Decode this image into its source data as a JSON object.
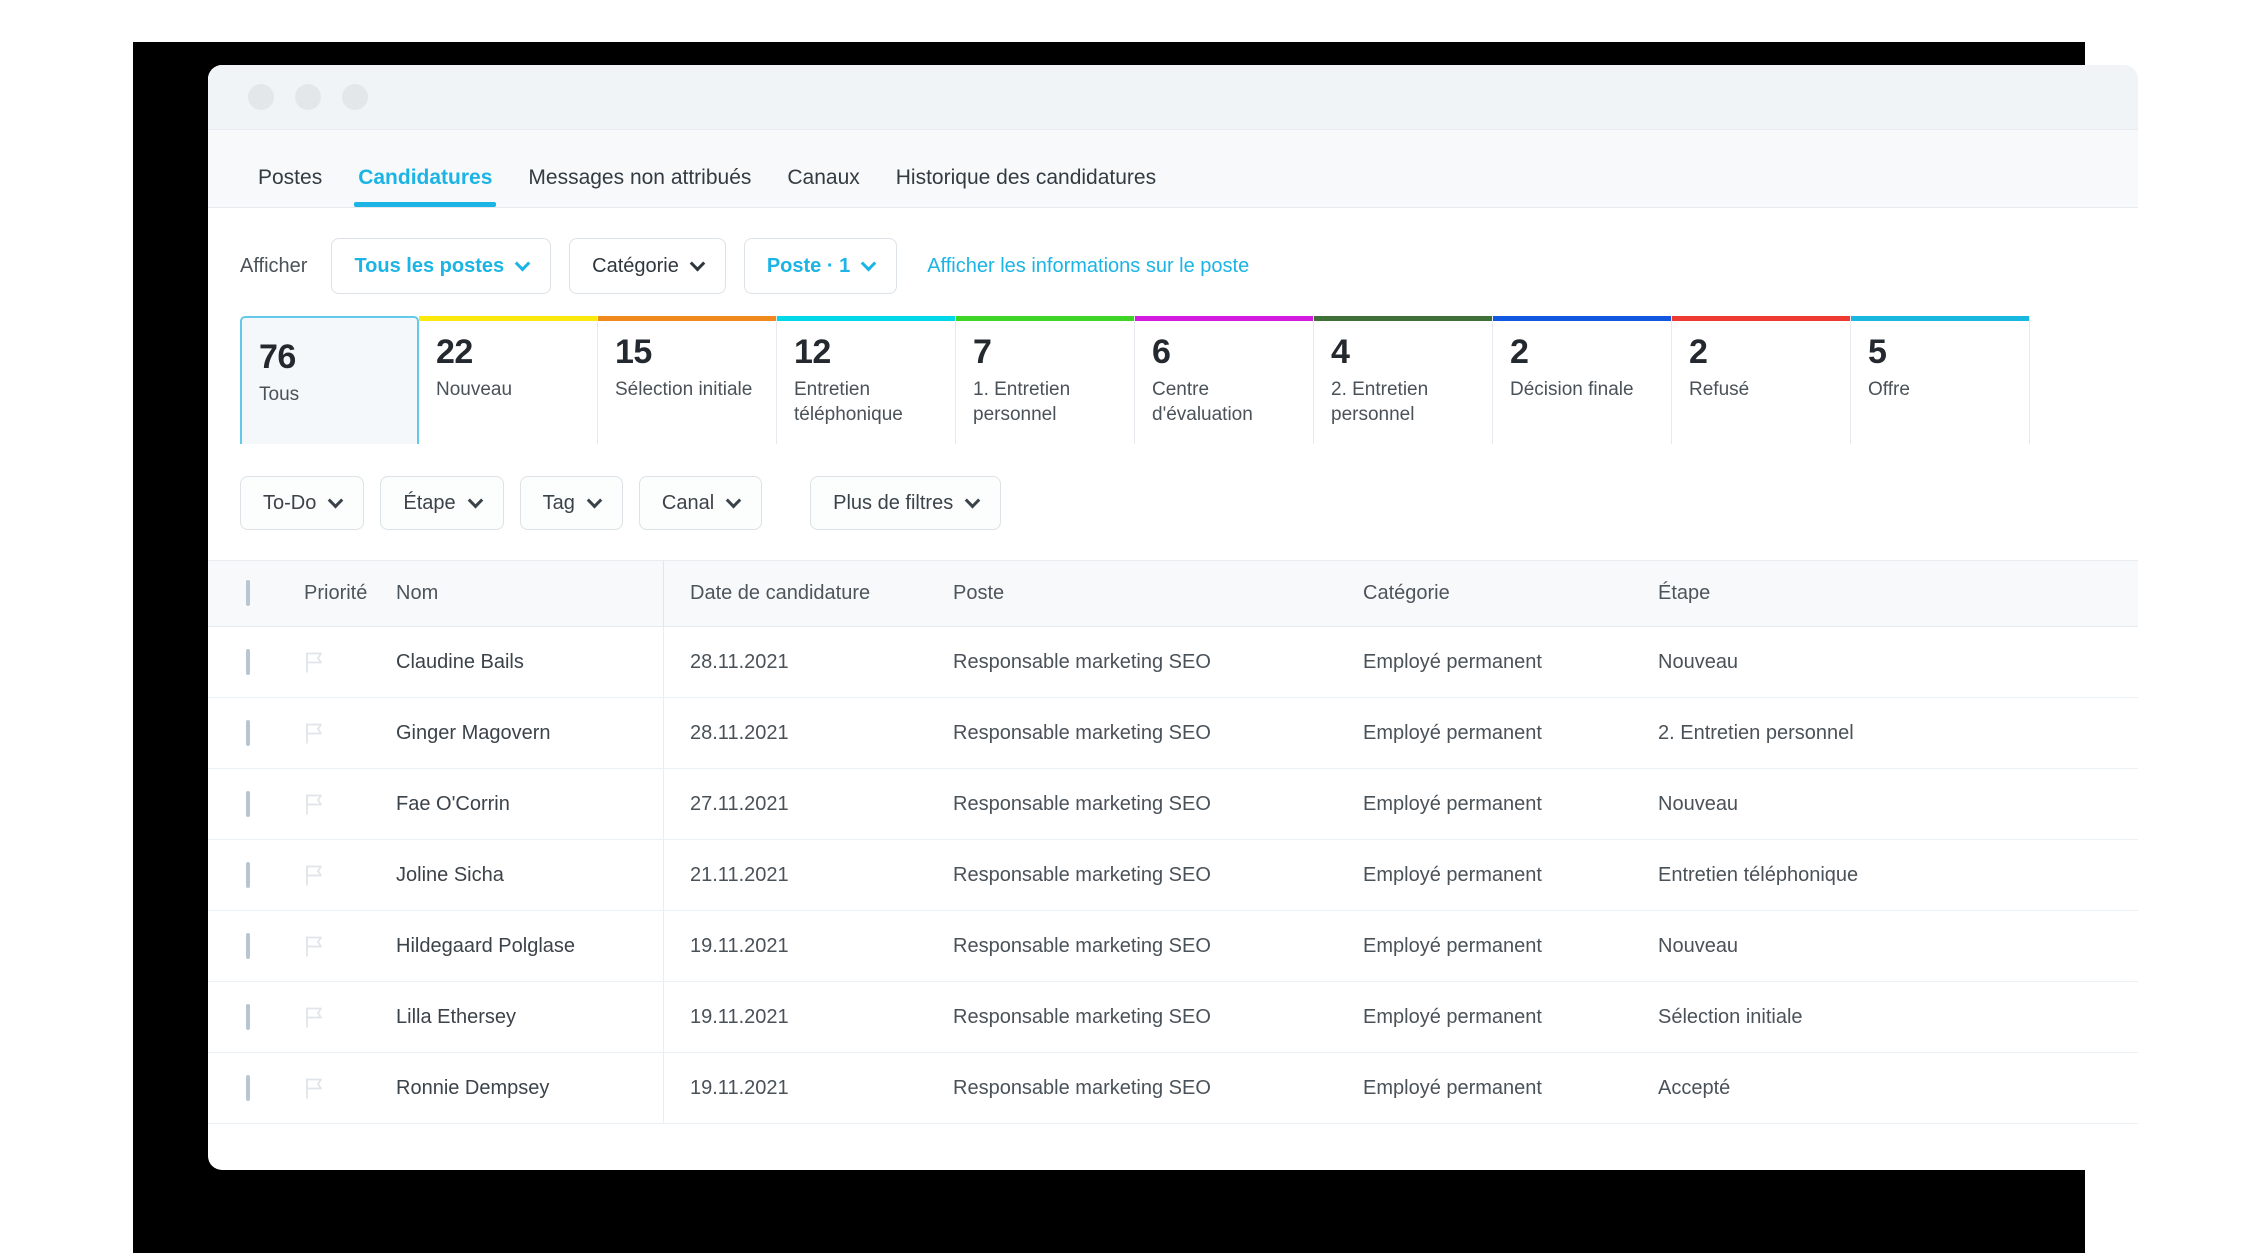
{
  "window": {
    "traffic_lights": [
      "close-dot",
      "minimize-dot",
      "maximize-dot"
    ]
  },
  "tabs": [
    {
      "label": "Postes",
      "active": false
    },
    {
      "label": "Candidatures",
      "active": true
    },
    {
      "label": "Messages non attribués",
      "active": false
    },
    {
      "label": "Canaux",
      "active": false
    },
    {
      "label": "Historique des candidatures",
      "active": false
    }
  ],
  "filterbar": {
    "afficher_label": "Afficher",
    "all_jobs": "Tous les postes",
    "category": "Catégorie",
    "job": "Poste · 1",
    "info_link": "Afficher les informations sur le poste",
    "accent_color": "#1bb4e4"
  },
  "stages": [
    {
      "count": "76",
      "name": "Tous",
      "color": "#63c9ea",
      "selected": true
    },
    {
      "count": "22",
      "name": "Nouveau",
      "color": "#fbe80c",
      "selected": false
    },
    {
      "count": "15",
      "name": "Sélection initiale",
      "color": "#f08a1c",
      "selected": false
    },
    {
      "count": "12",
      "name": "Entretien téléphonique",
      "color": "#00d8ea",
      "selected": false
    },
    {
      "count": "7",
      "name": "1. Entretien personnel",
      "color": "#3fd527",
      "selected": false
    },
    {
      "count": "6",
      "name": "Centre d'évaluation",
      "color": "#d419e0",
      "selected": false
    },
    {
      "count": "4",
      "name": "2. Entretien personnel",
      "color": "#3e7038",
      "selected": false
    },
    {
      "count": "2",
      "name": "Décision finale",
      "color": "#1257e0",
      "selected": false
    },
    {
      "count": "2",
      "name": "Refusé",
      "color": "#ee3a33",
      "selected": false
    },
    {
      "count": "5",
      "name": "Offre",
      "color": "#19b8e0",
      "selected": false
    }
  ],
  "subfilters": [
    {
      "label": "To-Do"
    },
    {
      "label": "Étape"
    },
    {
      "label": "Tag"
    },
    {
      "label": "Canal"
    },
    {
      "label": "Plus de filtres"
    }
  ],
  "table": {
    "columns": {
      "priority": "Priorité",
      "name": "Nom",
      "date": "Date de candidature",
      "job": "Poste",
      "category": "Catégorie",
      "stage": "Étape"
    },
    "rows": [
      {
        "name": "Claudine Bails",
        "date": "28.11.2021",
        "job": "Responsable marketing SEO",
        "category": "Employé permanent",
        "stage": "Nouveau"
      },
      {
        "name": "Ginger Magovern",
        "date": "28.11.2021",
        "job": "Responsable marketing SEO",
        "category": "Employé permanent",
        "stage": "2. Entretien personnel"
      },
      {
        "name": "Fae O'Corrin",
        "date": "27.11.2021",
        "job": "Responsable marketing SEO",
        "category": "Employé permanent",
        "stage": "Nouveau"
      },
      {
        "name": "Joline Sicha",
        "date": "21.11.2021",
        "job": "Responsable marketing SEO",
        "category": "Employé permanent",
        "stage": "Entretien téléphonique"
      },
      {
        "name": "Hildegaard Polglase",
        "date": "19.11.2021",
        "job": "Responsable marketing SEO",
        "category": "Employé permanent",
        "stage": "Nouveau"
      },
      {
        "name": "Lilla Ethersey",
        "date": "19.11.2021",
        "job": "Responsable marketing SEO",
        "category": "Employé permanent",
        "stage": "Sélection initiale"
      },
      {
        "name": "Ronnie Dempsey",
        "date": "19.11.2021",
        "job": "Responsable marketing SEO",
        "category": "Employé permanent",
        "stage": "Accepté"
      }
    ]
  }
}
